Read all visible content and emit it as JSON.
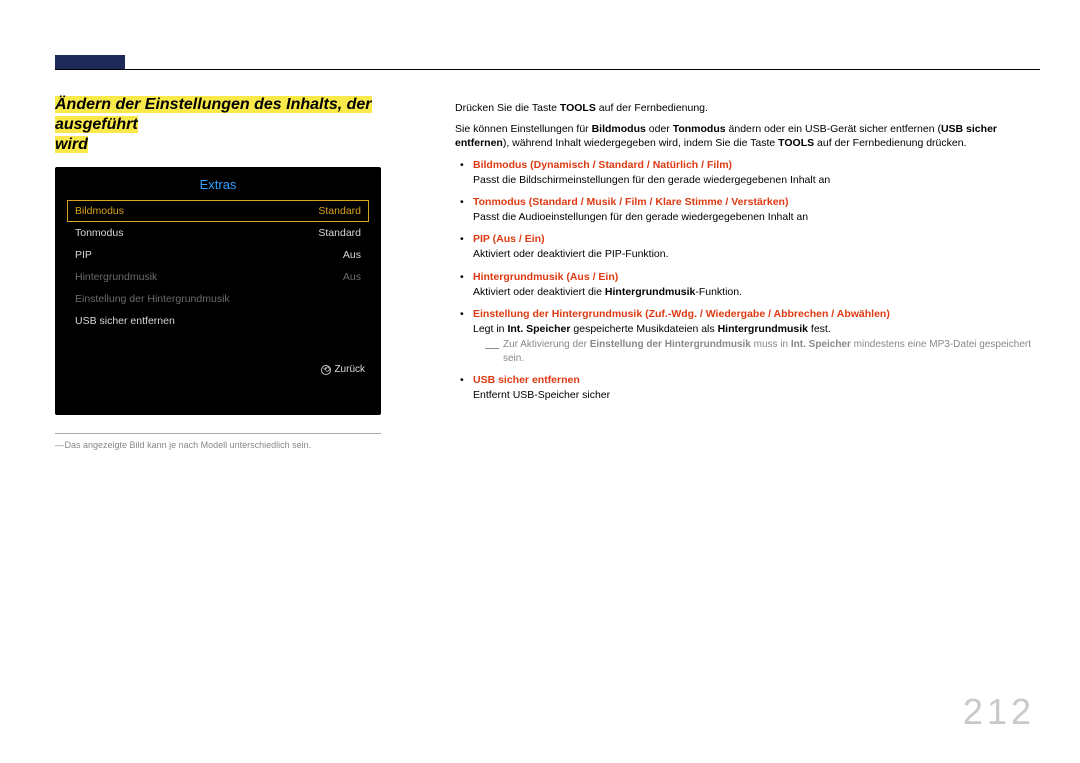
{
  "page_number": "212",
  "title_line1": "Ändern der Einstellungen des Inhalts, der ausgeführt",
  "title_line2": "wird",
  "tv": {
    "title": "Extras",
    "rows": [
      {
        "label": "Bildmodus",
        "value": "Standard",
        "state": "selected"
      },
      {
        "label": "Tonmodus",
        "value": "Standard",
        "state": ""
      },
      {
        "label": "PIP",
        "value": "Aus",
        "state": ""
      },
      {
        "label": "Hintergrundmusik",
        "value": "Aus",
        "state": "dim"
      },
      {
        "label": "Einstellung der Hintergrundmusik",
        "value": "",
        "state": "dim"
      },
      {
        "label": "USB sicher entfernen",
        "value": "",
        "state": ""
      }
    ],
    "back": "Zurück"
  },
  "caption": "Das angezeigte Bild kann je nach Modell unterschiedlich sein.",
  "intro1_a": "Drücken Sie die Taste ",
  "intro1_b": "TOOLS",
  "intro1_c": " auf der Fernbedienung.",
  "intro2_a": "Sie können Einstellungen für ",
  "intro2_b": "Bildmodus",
  "intro2_c": " oder ",
  "intro2_d": "Tonmodus",
  "intro2_e": " ändern oder ein USB-Gerät sicher entfernen (",
  "intro2_f": "USB sicher entfernen",
  "intro2_g": "), während Inhalt wiedergegeben wird, indem Sie die Taste ",
  "intro2_h": "TOOLS",
  "intro2_i": " auf der Fernbedienung drücken.",
  "items": [
    {
      "head": "Bildmodus (Dynamisch / Standard / Natürlich / Film)",
      "desc": "Passt die Bildschirmeinstellungen für den gerade wiedergegebenen Inhalt an"
    },
    {
      "head": "Tonmodus (Standard / Musik / Film / Klare Stimme / Verstärken)",
      "desc": "Passt die Audioeinstellungen für den gerade wiedergegebenen Inhalt an"
    },
    {
      "head": "PIP (Aus / Ein)",
      "desc": "Aktiviert oder deaktiviert die PIP-Funktion."
    },
    {
      "head": "Hintergrundmusik (Aus / Ein)"
    },
    {
      "head": "Einstellung der Hintergrundmusik (Zuf.-Wdg. / Wiedergabe / Abbrechen / Abwählen)"
    },
    {
      "head": "USB sicher entfernen",
      "desc": "Entfernt USB-Speicher sicher"
    }
  ],
  "hdesc_a": "Aktiviert oder deaktiviert die ",
  "hdesc_b": "Hintergrundmusik",
  "hdesc_c": "-Funktion.",
  "edesc_a": "Legt in ",
  "edesc_b": "Int. Speicher",
  "edesc_c": " gespeicherte Musikdateien als ",
  "edesc_d": "Hintergrundmusik",
  "edesc_e": " fest.",
  "note_a": "Zur Aktivierung der ",
  "note_b": "Einstellung der Hintergrundmusik",
  "note_c": " muss in ",
  "note_d": "Int. Speicher",
  "note_e": " mindestens eine MP3-Datei gespeichert sein."
}
